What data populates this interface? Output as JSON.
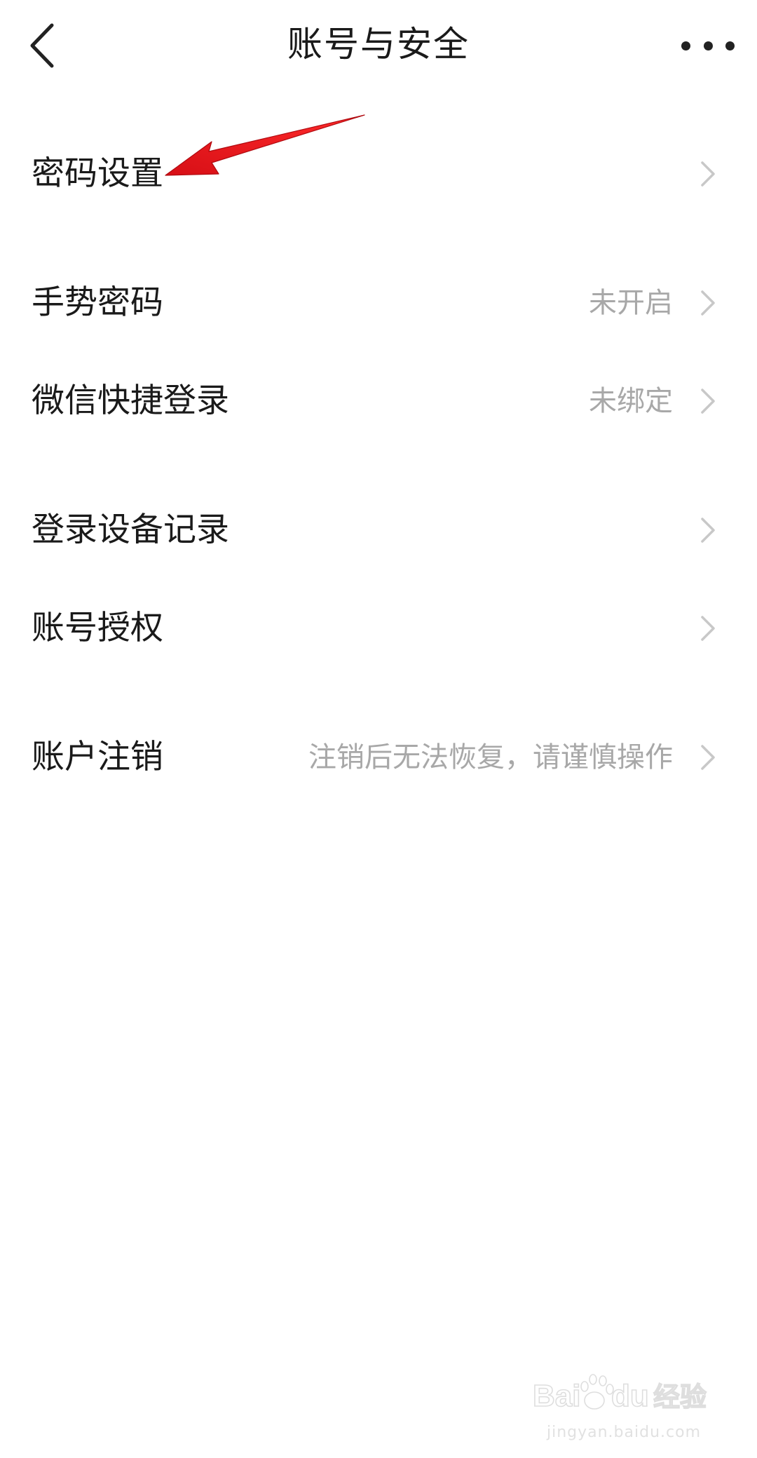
{
  "header": {
    "title": "账号与安全",
    "back_icon": "chevron-left-icon",
    "more_icon": "more-horizontal-icon"
  },
  "rows": [
    {
      "label": "密码设置",
      "value": ""
    },
    {
      "label": "手势密码",
      "value": "未开启"
    },
    {
      "label": "微信快捷登录",
      "value": "未绑定"
    },
    {
      "label": "登录设备记录",
      "value": ""
    },
    {
      "label": "账号授权",
      "value": ""
    },
    {
      "label": "账户注销",
      "value": "注销后无法恢复，请谨慎操作"
    }
  ],
  "watermark": {
    "text": "Baidu经验",
    "url": "jingyan.baidu.com"
  },
  "colors": {
    "text_primary": "#1a1a1a",
    "text_secondary": "#a8a8a8",
    "chevron": "#c8c8c8",
    "annotation_arrow": "#e8121a"
  }
}
